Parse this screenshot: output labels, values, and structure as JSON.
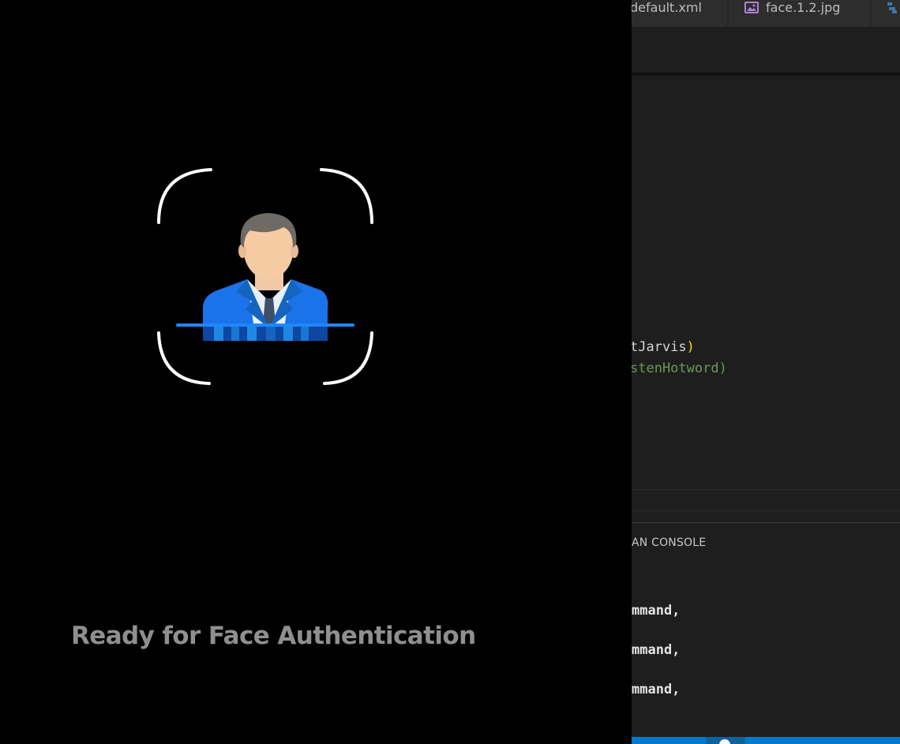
{
  "overlay": {
    "status_text": "Ready for Face Authentication",
    "icons": {
      "scan_frame": "face-scan-frame-icon",
      "avatar": "businessman-avatar-icon"
    },
    "colors": {
      "background": "#000000",
      "status_text": "#8f8f8f",
      "frame": "#ffffff",
      "suit": "#1a73e8",
      "scan_line": "#1e88ff"
    }
  },
  "editor": {
    "tabs": [
      {
        "label": "default.xml"
      },
      {
        "label": "face.1.2.jpg",
        "icon": "image-file-icon"
      },
      {
        "label": "",
        "icon": "python-file-icon"
      }
    ],
    "code": {
      "line1_text": "tJarvis",
      "line1_paren": ")",
      "line2": "stenHotword)"
    },
    "panel": {
      "title": "AN CONSOLE",
      "lines": [
        "mmand,",
        "mmand,",
        "mmand,"
      ]
    },
    "colors": {
      "background": "#1e1e1e",
      "tab_bar": "#252526",
      "status_bar": "#007acc",
      "comment_green": "#6a9955",
      "paren_yellow": "#ffd700"
    }
  }
}
